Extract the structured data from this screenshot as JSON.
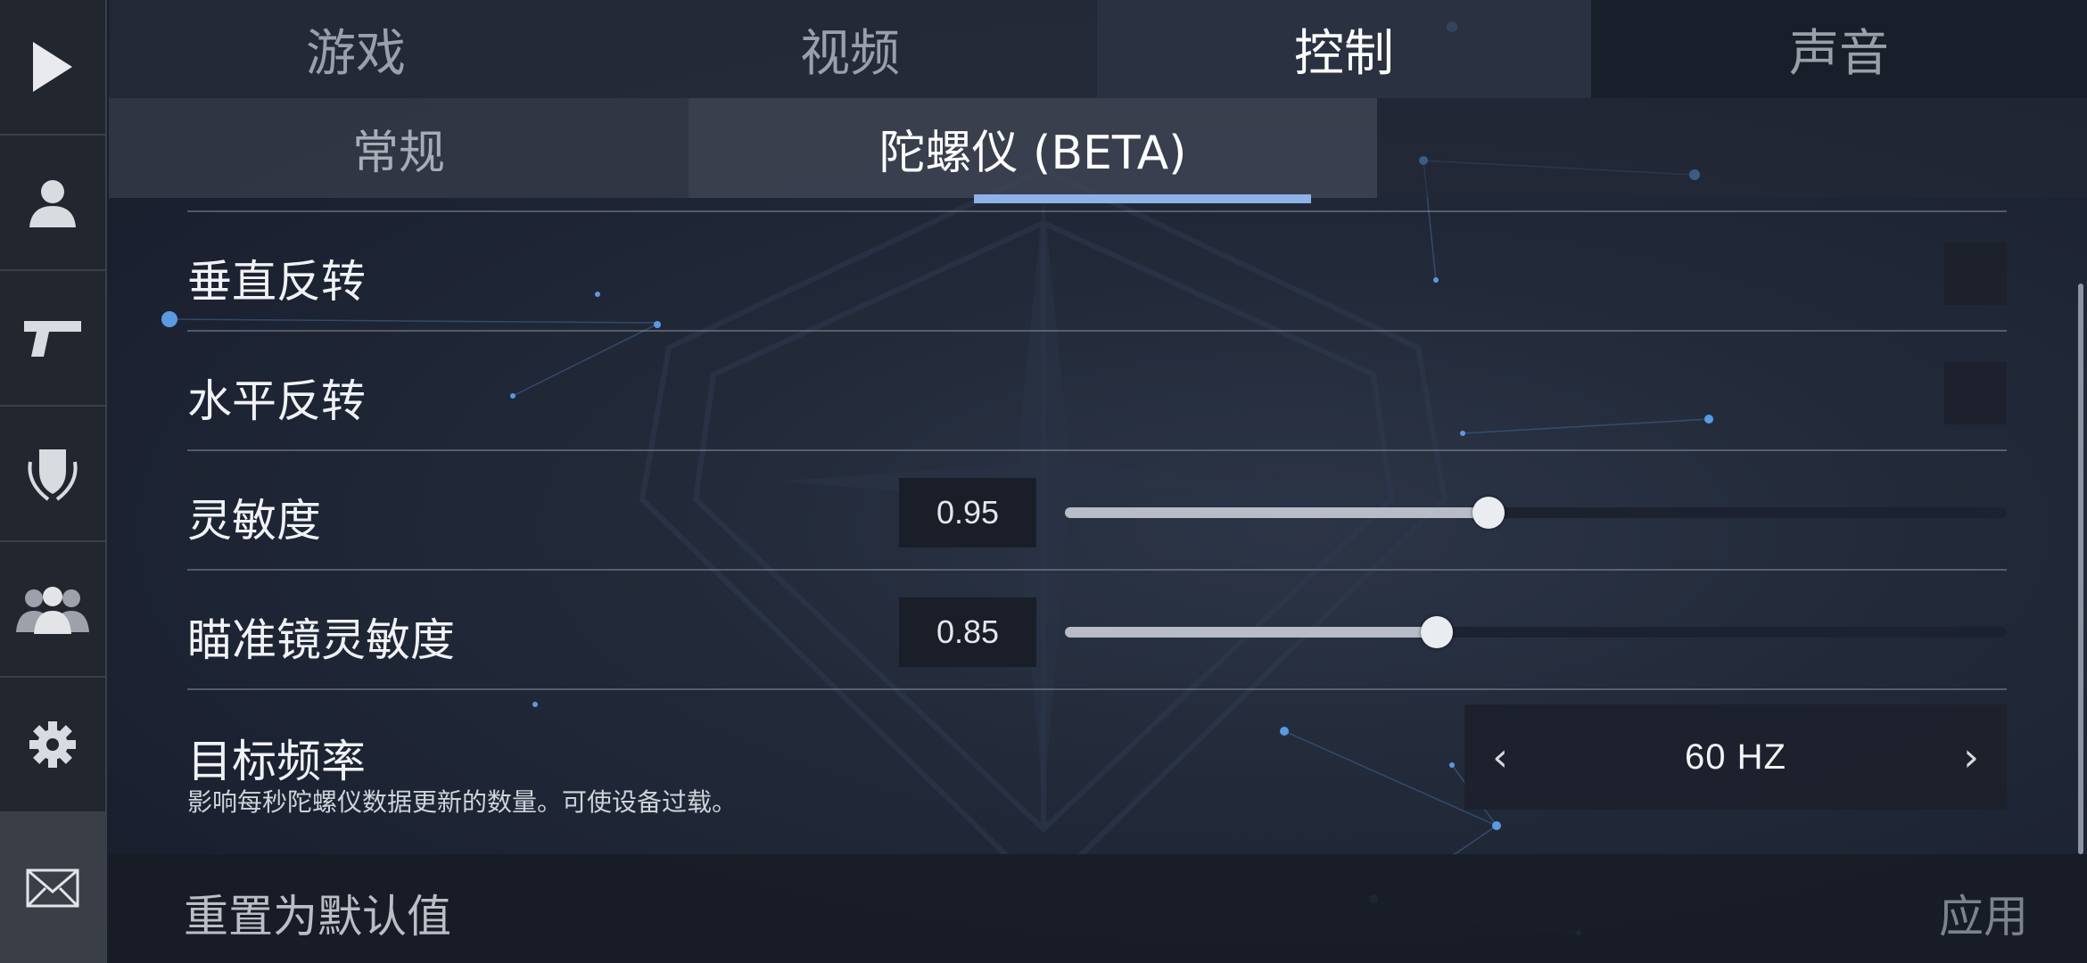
{
  "sidebar": {
    "items": [
      {
        "icon": "play-icon"
      },
      {
        "icon": "profile-icon"
      },
      {
        "icon": "pistol-icon"
      },
      {
        "icon": "shield-laurel-icon"
      },
      {
        "icon": "friends-icon"
      },
      {
        "icon": "gear-icon"
      },
      {
        "icon": "mail-icon"
      }
    ],
    "active_index": 6
  },
  "top_tabs": [
    {
      "label": "游戏"
    },
    {
      "label": "视频"
    },
    {
      "label": "控制"
    },
    {
      "label": "声音"
    }
  ],
  "top_active": "控制",
  "sub_tabs": [
    {
      "label": "常规"
    },
    {
      "label": "陀螺仪 (BETA)"
    }
  ],
  "sub_active": "陀螺仪 (BETA)",
  "settings": {
    "vertical_invert": {
      "label": "垂直反转",
      "checked": false
    },
    "horizontal_invert": {
      "label": "水平反转",
      "checked": false
    },
    "sensitivity": {
      "label": "灵敏度",
      "value": "0.95",
      "fraction": 0.45
    },
    "scope_sensitivity": {
      "label": "瞄准镜灵敏度",
      "value": "0.85",
      "fraction": 0.395
    },
    "target_frequency": {
      "label": "目标频率",
      "description": "影响每秒陀螺仪数据更新的数量。可使设备过载。",
      "value": "60 HZ",
      "prev_arrow": "‹",
      "next_arrow": "›"
    }
  },
  "footer": {
    "reset_label": "重置为默认值",
    "apply_label": "应用"
  },
  "colors": {
    "accent_underline": "#8fb2e8",
    "star_blue": "#4f8fd6"
  }
}
